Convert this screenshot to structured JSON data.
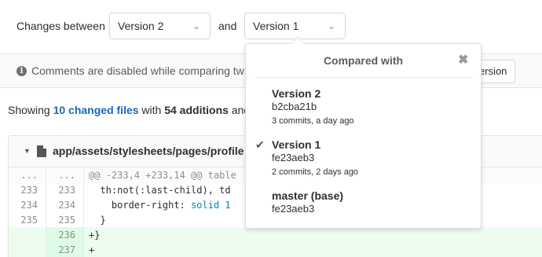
{
  "compare": {
    "label": "Changes between",
    "from_value": "Version 2",
    "joiner": "and",
    "to_value": "Version 1"
  },
  "notice": {
    "text": "Comments are disabled while comparing tw",
    "button_label": "ersion"
  },
  "summary": {
    "prefix": "Showing",
    "changed_files": "10 changed files",
    "with": "with",
    "additions": "54 additions",
    "tail": "and"
  },
  "file": {
    "path": "app/assets/stylesheets/pages/profile",
    "lines": [
      {
        "old": "...",
        "new": "...",
        "code": "@@ -233,4 +233,14 @@ table",
        "type": "match"
      },
      {
        "old": "233",
        "new": "233",
        "code": "  th:not(:last-child), td",
        "type": "normal"
      },
      {
        "old": "234",
        "new": "234",
        "code": "    border-right: ",
        "code_blue": "solid 1",
        "type": "normal"
      },
      {
        "old": "235",
        "new": "235",
        "code": "  }",
        "type": "normal"
      },
      {
        "old": "",
        "new": "236",
        "code": "+}",
        "type": "added"
      },
      {
        "old": "",
        "new": "237",
        "code": "+",
        "type": "added"
      }
    ]
  },
  "dropdown": {
    "title": "Compared with",
    "options": [
      {
        "name": "Version 2",
        "sha": "b2cba21b",
        "meta": "3 commits, a day ago",
        "selected": false
      },
      {
        "name": "Version 1",
        "sha": "fe23aeb3",
        "meta": "2 commits, 2 days ago",
        "selected": true
      },
      {
        "name": "master (base)",
        "sha": "fe23aeb3",
        "meta": "",
        "selected": false
      }
    ]
  },
  "colors": {
    "link": "#1b69b6",
    "added_bg": "#ecfdf0"
  }
}
